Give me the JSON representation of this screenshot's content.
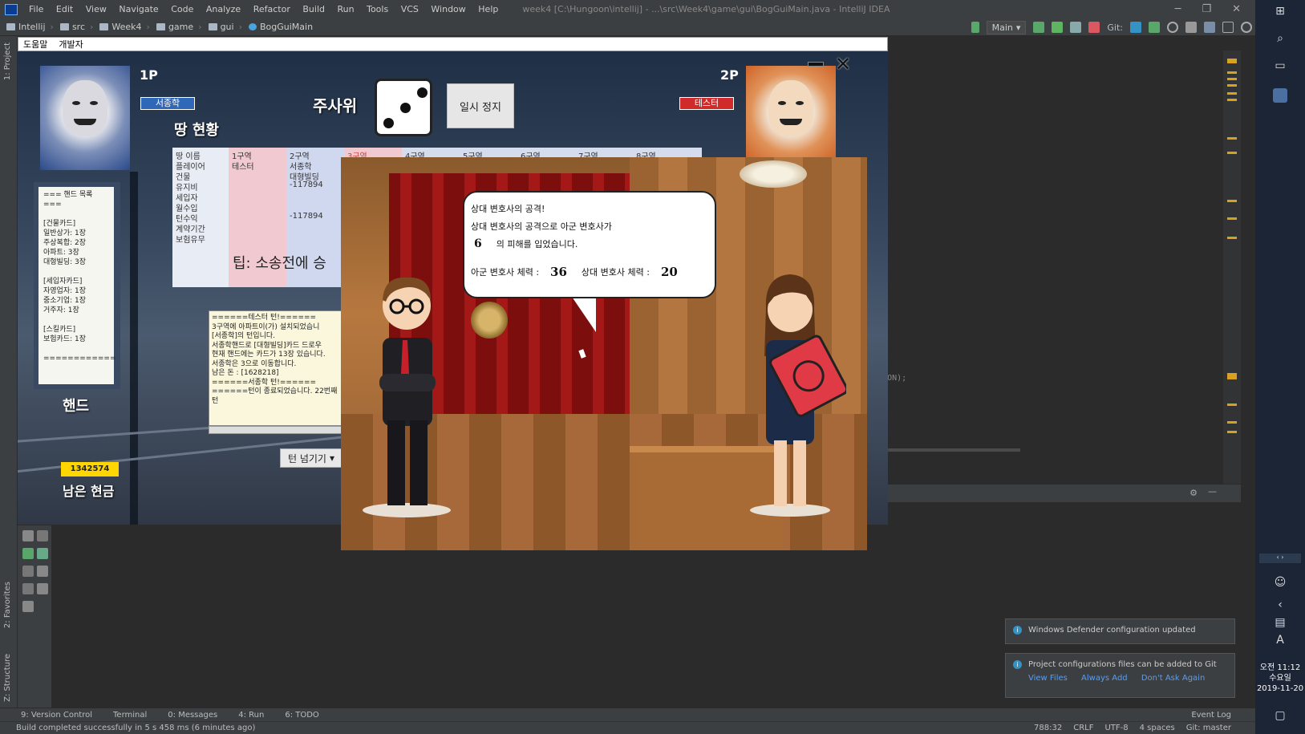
{
  "ide": {
    "menu": [
      "File",
      "Edit",
      "View",
      "Navigate",
      "Code",
      "Analyze",
      "Refactor",
      "Build",
      "Run",
      "Tools",
      "VCS",
      "Window",
      "Help"
    ],
    "window_title": "week4 [C:\\Hungoon\\intellij] - ...\\src\\Week4\\game\\gui\\BogGuiMain.java - IntelliJ IDEA",
    "breadcrumbs": [
      "Intellij",
      "src",
      "Week4",
      "game",
      "gui",
      "BogGuiMain"
    ],
    "run_config": "Main",
    "git_label": "Git:",
    "left_tabs": [
      "1: Project",
      "2: Favorites",
      "Z: Structure"
    ],
    "bottom_tabs": [
      "9: Version Control",
      "Terminal",
      "0: Messages",
      "4: Run",
      "6: TODO"
    ],
    "event_log": "Event Log",
    "status_message": "Build completed successfully in 5 s 458 ms (6 minutes ago)",
    "status_right": [
      "788:32",
      "CRLF",
      "UTF-8",
      "4 spaces",
      "Git: master"
    ],
    "code_fragment": "IAS_ON);",
    "notifications": [
      {
        "text": "Windows Defender configuration updated",
        "links": []
      },
      {
        "text": "Project configurations files can be added to Git",
        "links": [
          "View Files",
          "Always Add",
          "Don't Ask Again"
        ]
      }
    ]
  },
  "taskbar": {
    "time": "오전 11:12",
    "weekday": "수요일",
    "date": "2019-11-20",
    "ime": "A"
  },
  "game": {
    "menu": [
      "도움말",
      "개발자"
    ],
    "player1": {
      "label": "1P",
      "name": "서종학"
    },
    "player2": {
      "label": "2P",
      "name": "테스터"
    },
    "dice_label": "주사위",
    "dice_value": 3,
    "pause_label": "일시 정지",
    "land_title": "땅 현황",
    "land_table": {
      "row_headers": [
        "땅 이름",
        "플레이어",
        "건물",
        "유지비",
        "세입자",
        "월수입",
        "턴수익",
        "계약기간",
        "보험유무"
      ],
      "columns": [
        {
          "name": "1구역",
          "player": "테스터",
          "building": "",
          "upkeep": "",
          "net": ""
        },
        {
          "name": "2구역",
          "player": "서종학",
          "building": "대형빌딩",
          "upkeep": "-117894",
          "net": "-117894"
        },
        {
          "name": "3구역",
          "player": "",
          "building": "",
          "upkeep": "",
          "net": ""
        },
        {
          "name": "4구역",
          "player": "",
          "building": "",
          "upkeep": "",
          "net": ""
        },
        {
          "name": "5구역",
          "player": "",
          "building": "",
          "upkeep": "",
          "net": ""
        },
        {
          "name": "6구역",
          "player": "",
          "building": "",
          "upkeep": "",
          "net": ""
        },
        {
          "name": "7구역",
          "player": "",
          "building": "",
          "upkeep": "",
          "net": ""
        },
        {
          "name": "8구역",
          "player": "",
          "building": "",
          "upkeep": "",
          "net": ""
        }
      ]
    },
    "tip": "팁: 소송전에 승",
    "hand_list": [
      "=== 핸드 목록 ===",
      "",
      "[건물카드]",
      "일반상가: 1장",
      "주상복합: 2장",
      "아파트: 3장",
      "대형빌딩: 3장",
      "",
      "[세입자카드]",
      "자영업자: 1장",
      "중소기업: 1장",
      "거주자: 1장",
      "",
      "[스킬카드]",
      "보험카드: 1장",
      "",
      "============"
    ],
    "hand_label": "핸드",
    "cash_value": "1342574",
    "cash_label": "남은 현금",
    "log_lines": [
      "======테스터 턴!======",
      "3구역에 아파트이(가) 설치되었습니",
      "[서종학]의 턴입니다.",
      "서종학핸드로 [대형빌딩]카드 드로우",
      "현재 핸드에는 카드가 13장 있습니다.",
      "서종학은 3으로 이동합니다.",
      "남은 돈 : [1628218]",
      "======서종학 턴!======",
      "======턴이 종료되었습니다. 22번째 턴"
    ],
    "turn_button": "턴 넘기기",
    "court": {
      "line1": "상대 변호사의 공격!",
      "line2": "상대 변호사의 공격으로 아군 변호사가",
      "damage": "6",
      "line3": "의 피해를 입었습니다.",
      "ally_label": "아군 변호사 체력 :",
      "ally_hp": "36",
      "enemy_label": "상대 변호사 체력 :",
      "enemy_hp": "20"
    }
  }
}
